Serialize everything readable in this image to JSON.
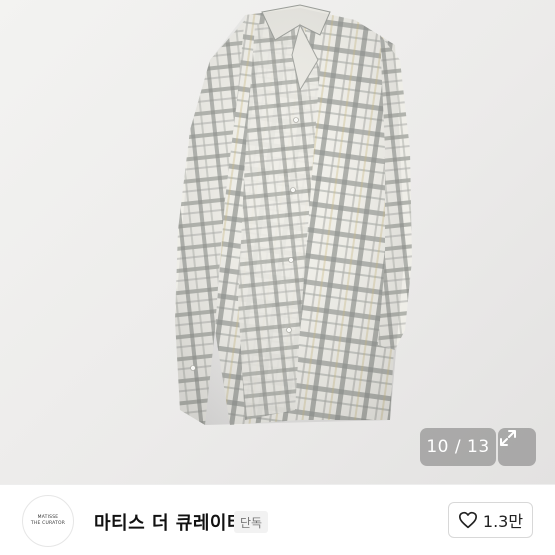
{
  "gallery": {
    "counter": "10 / 13",
    "image_alt": "plaid shirt hanging on wall"
  },
  "seller": {
    "avatar_line1": "MATISSE",
    "avatar_line2": "THE CURATOR",
    "name": "마티스 더 큐레이터",
    "badge": "단독"
  },
  "like": {
    "count": "1.3만"
  },
  "colors": {
    "plaid_base": "#f0efe9",
    "plaid_line": "#8e918d",
    "counter_bg": "rgba(120,120,120,0.55)"
  }
}
